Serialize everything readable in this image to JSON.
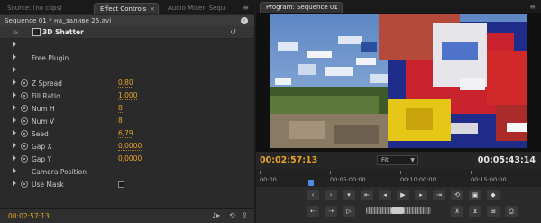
{
  "left_panel": {
    "tabs": [
      "Source: (no clips)",
      "Effect Controls",
      "Audio Mixer: Sequ"
    ],
    "tab_close": "×",
    "sequence_header": "Sequence 01 * на_заливе 25.avi",
    "effect": {
      "fx_badge": "fx",
      "name": "3D Shatter"
    },
    "rows": [
      {
        "label": "",
        "value": ""
      },
      {
        "label": "Free Plugin",
        "value": ""
      },
      {
        "label": "",
        "value": ""
      },
      {
        "label": "Z Spread",
        "value": "0,80"
      },
      {
        "label": "Fill Ratio",
        "value": "1,000"
      },
      {
        "label": "Num H",
        "value": "8"
      },
      {
        "label": "Num V",
        "value": "8"
      },
      {
        "label": "Seed",
        "value": "6,79"
      },
      {
        "label": "Gap X",
        "value": "0,0000"
      },
      {
        "label": "Gap Y",
        "value": "0,0000"
      },
      {
        "label": "Camera Position",
        "value": ""
      },
      {
        "label": "Use Mask",
        "value": ""
      }
    ],
    "timecode": "00:02:57:13"
  },
  "right_panel": {
    "tab": "Program: Sequence 01",
    "tab_close": "×",
    "timecode_current": "00:02:57:13",
    "fit": "Fit",
    "timecode_duration": "00:05:43:14",
    "ruler_labels": [
      "00:00",
      "00:05:00:00",
      "00:10:00:00",
      "00:15:00:00"
    ]
  },
  "colors": {
    "accent_timecode": "#e8a52a",
    "playhead": "#4d8ee8"
  }
}
